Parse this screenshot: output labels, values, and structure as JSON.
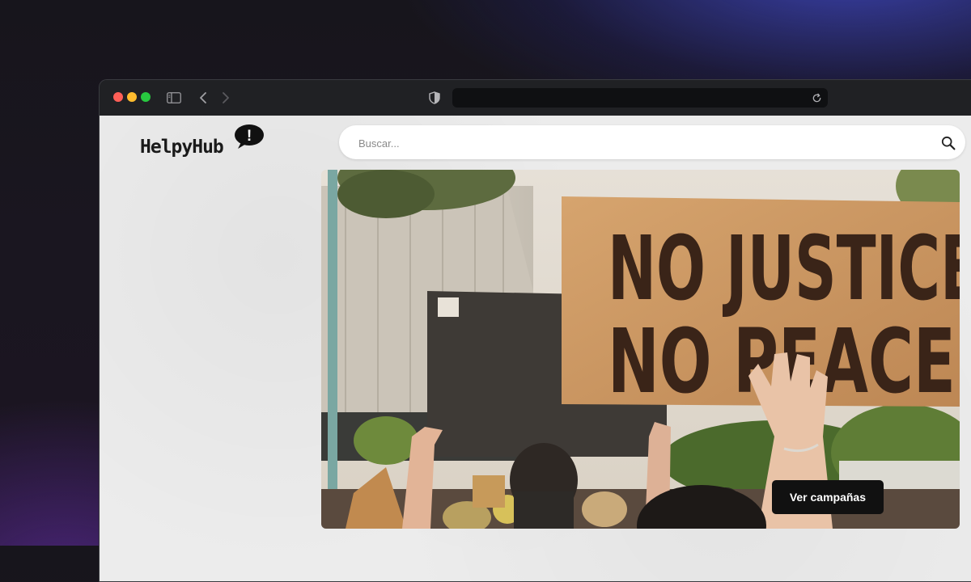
{
  "browser": {
    "url": "",
    "icons": [
      "sidebar-icon",
      "chevron-left-icon",
      "chevron-right-icon",
      "shield-icon",
      "reload-icon"
    ]
  },
  "site": {
    "logo_text": "HelpyHub",
    "logo_badge": "!"
  },
  "search": {
    "placeholder": "Buscar...",
    "icon": "search-icon"
  },
  "hero": {
    "sign_line_1": "NO JUSTICE",
    "sign_line_2": "NO PEACE",
    "cta_label": "Ver campañas"
  },
  "colors": {
    "brand_dark": "#111111",
    "page_background": "#ececec",
    "sign_cardboard": "#c9955f"
  }
}
